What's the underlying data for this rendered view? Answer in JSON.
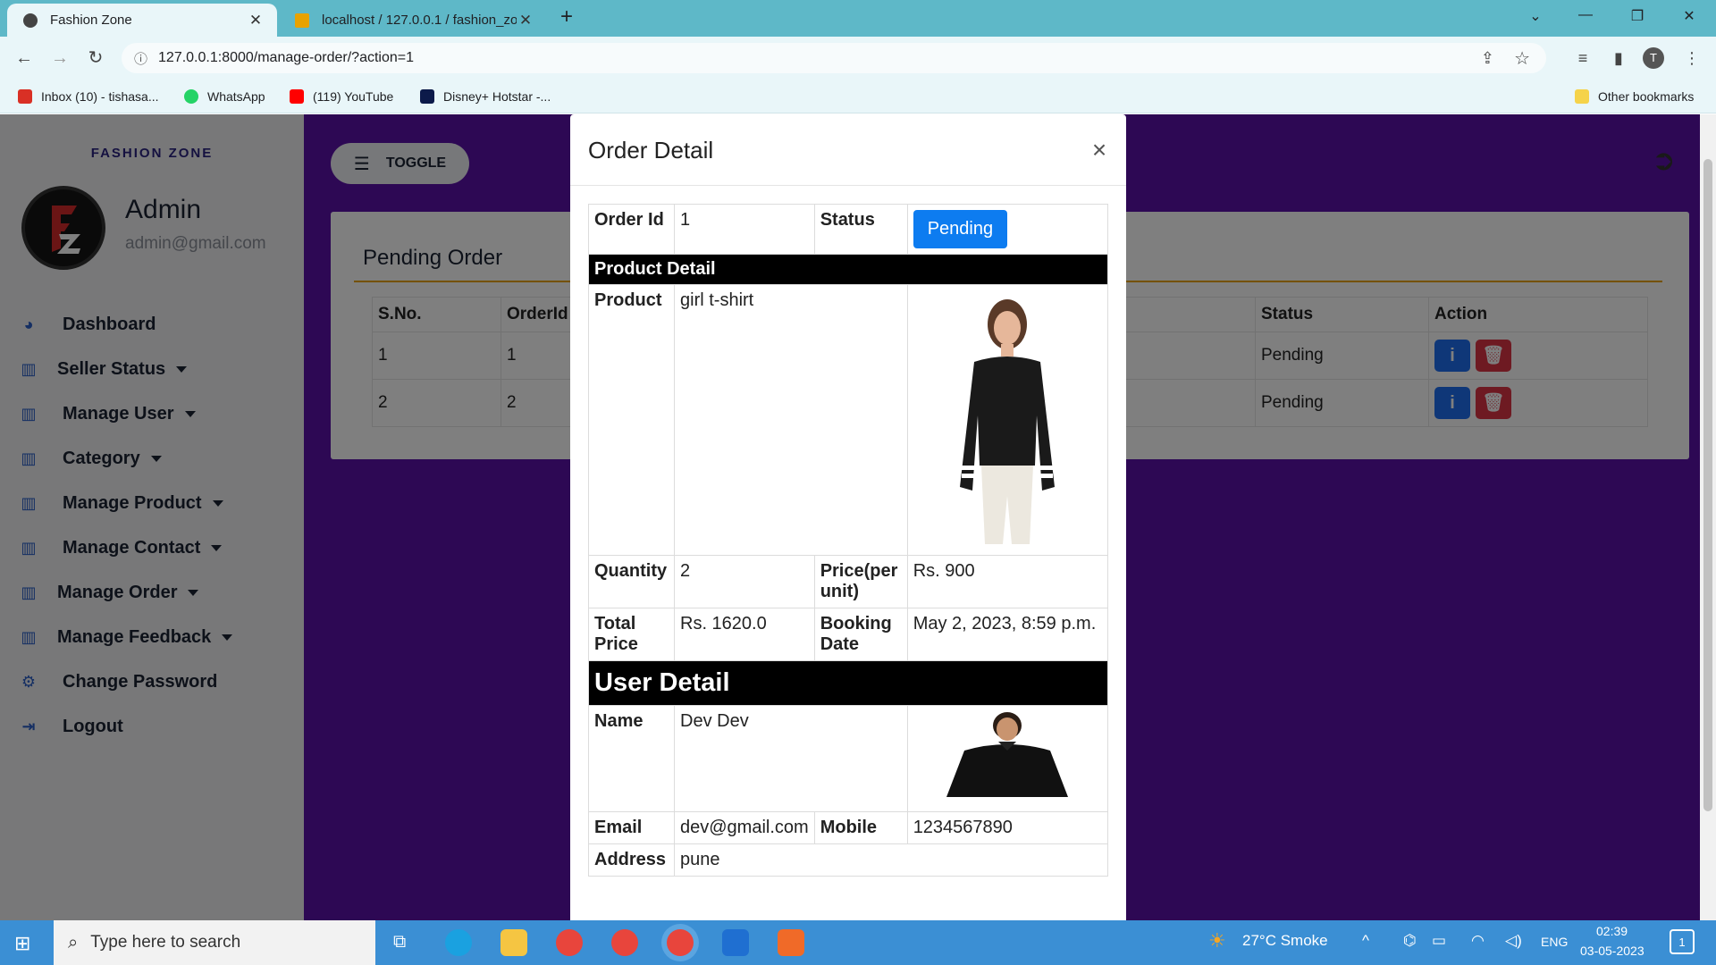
{
  "browser": {
    "tabs": [
      {
        "title": "Fashion Zone"
      },
      {
        "title": "localhost / 127.0.0.1 / fashion_zo"
      }
    ],
    "url": "127.0.0.1:8000/manage-order/?action=1",
    "bookmarks": [
      {
        "label": "Inbox (10) - tishasa..."
      },
      {
        "label": "WhatsApp"
      },
      {
        "label": "(119) YouTube"
      },
      {
        "label": "Disney+ Hotstar -..."
      }
    ],
    "other_bookmarks": "Other bookmarks",
    "profile_initial": "T"
  },
  "sidebar": {
    "brand": "FASHION ZONE",
    "logo_text": "FZ",
    "user_name": "Admin",
    "user_email": "admin@gmail.com",
    "items": [
      {
        "label": "Dashboard",
        "icon": "dashboard-icon",
        "dropdown": false
      },
      {
        "label": "Seller Status",
        "icon": "chart-icon",
        "dropdown": true
      },
      {
        "label": "Manage User",
        "icon": "chart-icon",
        "dropdown": true
      },
      {
        "label": "Category",
        "icon": "chart-icon",
        "dropdown": true
      },
      {
        "label": "Manage Product",
        "icon": "chart-icon",
        "dropdown": true
      },
      {
        "label": "Manage Contact",
        "icon": "chart-icon",
        "dropdown": true
      },
      {
        "label": "Manage Order",
        "icon": "chart-icon",
        "dropdown": true
      },
      {
        "label": "Manage Feedback",
        "icon": "chart-icon",
        "dropdown": true
      },
      {
        "label": "Change Password",
        "icon": "gear-icon",
        "dropdown": false
      },
      {
        "label": "Logout",
        "icon": "logout-icon",
        "dropdown": false
      }
    ]
  },
  "main": {
    "toggle_label": "TOGGLE",
    "card_title": "Pending Order",
    "columns": [
      "S.No.",
      "OrderId",
      "Status",
      "Action"
    ],
    "rows": [
      {
        "sno": "1",
        "order_id": "1",
        "status": "Pending"
      },
      {
        "sno": "2",
        "order_id": "2",
        "status": "Pending"
      }
    ]
  },
  "modal": {
    "title": "Order Detail",
    "close_label": "×",
    "order_id_label": "Order Id",
    "order_id": "1",
    "status_label": "Status",
    "status": "Pending",
    "product_section": "Product Detail",
    "product_label": "Product",
    "product": "girl t-shirt",
    "quantity_label": "Quantity",
    "quantity": "2",
    "price_label": "Price(per unit)",
    "price": "Rs. 900",
    "total_label": "Total Price",
    "total": "Rs. 1620.0",
    "booking_label": "Booking Date",
    "booking_date": "May 2, 2023, 8:59 p.m.",
    "user_section": "User Detail",
    "name_label": "Name",
    "name": "Dev Dev",
    "email_label": "Email",
    "email": "dev@gmail.com",
    "mobile_label": "Mobile",
    "mobile": "1234567890",
    "address_label": "Address",
    "address": "pune"
  },
  "taskbar": {
    "search_placeholder": "Type here to search",
    "weather": "27°C  Smoke",
    "language": "ENG",
    "time": "02:39",
    "date": "03-05-2023",
    "notification_count": "1"
  },
  "colors": {
    "page_bg": "#5a10a8",
    "accent_blue": "#0d7cf0",
    "danger": "#dc3545",
    "rule": "#e8a200"
  }
}
